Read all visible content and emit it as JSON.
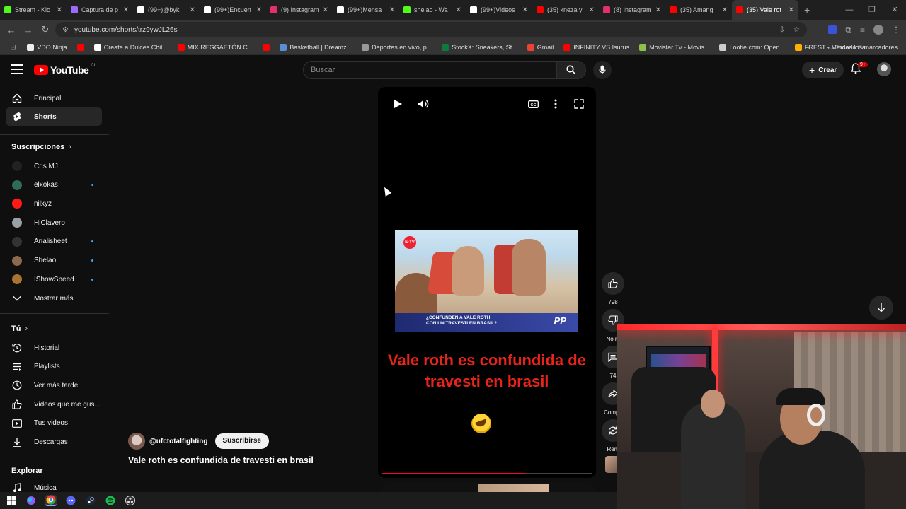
{
  "browser": {
    "tabs": [
      {
        "label": "Stream - Kic",
        "color": "#53fc18"
      },
      {
        "label": "Captura de p",
        "color": "#9b6bff"
      },
      {
        "label": "(99+)@byki",
        "color": "#ffffff"
      },
      {
        "label": "(99+)Encuen",
        "color": "#ffffff"
      },
      {
        "label": "(9) Instagram",
        "color": "#e1306c"
      },
      {
        "label": "(99+)Mensa",
        "color": "#ffffff"
      },
      {
        "label": "shelao - Wa",
        "color": "#53fc18"
      },
      {
        "label": "(99+)Videos",
        "color": "#ffffff"
      },
      {
        "label": "(35) kneza y",
        "color": "#ff0000"
      },
      {
        "label": "(8) Instagram",
        "color": "#e1306c"
      },
      {
        "label": "(35) Amang",
        "color": "#ff0000"
      },
      {
        "label": "(35) Vale rot",
        "color": "#ff0000",
        "active": true
      }
    ],
    "url": "youtube.com/shorts/trz9ywJL26s",
    "bookmarks": [
      {
        "label": "VDO.Ninja",
        "color": "#eeeeee"
      },
      {
        "label": "",
        "color": "#ff0000"
      },
      {
        "label": "Create a Dulces Chil...",
        "color": "#ffffff"
      },
      {
        "label": "MIX REGGAETÓN C...",
        "color": "#ff0000"
      },
      {
        "label": "",
        "color": "#ff0000"
      },
      {
        "label": "Basketball | Dreamz...",
        "color": "#5b8dd6"
      },
      {
        "label": "Deportes en vivo, p...",
        "color": "#999999"
      },
      {
        "label": "StockX: Sneakers, St...",
        "color": "#0f7a3e"
      },
      {
        "label": "Gmail",
        "color": "#ea4335"
      },
      {
        "label": "INFINITY VS Isurus",
        "color": "#ff0000"
      },
      {
        "label": "Movistar Tv - Movis...",
        "color": "#8bc34a"
      },
      {
        "label": "Lootie.com: Open...",
        "color": "#cccccc"
      },
      {
        "label": "FREST - Mercado Sa...",
        "color": "#ffb000"
      }
    ],
    "all_bookmarks": "Todos los marcadores"
  },
  "header": {
    "logo": "YouTube",
    "country": "CL",
    "search_placeholder": "Buscar",
    "create_label": "Crear",
    "notif_badge": "9+"
  },
  "sidebar": {
    "main": [
      {
        "label": "Principal",
        "icon": "home-icon"
      },
      {
        "label": "Shorts",
        "icon": "shorts-icon",
        "active": true
      }
    ],
    "subs_title": "Suscripciones",
    "subs": [
      {
        "label": "Cris MJ",
        "color": "#222222",
        "dot": false
      },
      {
        "label": "elxokas",
        "color": "#2f6b58",
        "dot": true
      },
      {
        "label": "nilxyz",
        "color": "#ff1a1a",
        "dot": false
      },
      {
        "label": "HiClavero",
        "color": "#9aa0a6",
        "dot": false
      },
      {
        "label": "Analisheet",
        "color": "#333333",
        "dot": true
      },
      {
        "label": "Shelao",
        "color": "#8a6a4a",
        "dot": true
      },
      {
        "label": "IShowSpeed",
        "color": "#a8742f",
        "dot": true
      }
    ],
    "show_more": "Mostrar más",
    "you_title": "Tú",
    "you": [
      {
        "label": "Historial",
        "icon": "history-icon"
      },
      {
        "label": "Playlists",
        "icon": "playlist-icon"
      },
      {
        "label": "Ver más tarde",
        "icon": "clock-icon"
      },
      {
        "label": "Videos que me gus...",
        "icon": "like-icon"
      },
      {
        "label": "Tus videos",
        "icon": "video-icon"
      },
      {
        "label": "Descargas",
        "icon": "download-icon"
      }
    ],
    "explore_title": "Explorar",
    "explore": [
      {
        "label": "Música",
        "icon": "music-icon"
      }
    ]
  },
  "short": {
    "thumb_banner": "¿CONFUNDEN A VALE ROTH\nCON UN TRAVESTI EN BRASIL?",
    "thumb_logo": "E-TV",
    "thumb_brand": "PP",
    "caption": "Vale roth es confundida de travesti en brasil",
    "progress": 0.68,
    "channel": "@ufctotalfighting",
    "subscribe_label": "Suscribirse",
    "title": "Vale roth es confundida de travesti en brasil"
  },
  "actions": {
    "like_count": "798",
    "dislike_label": "No m",
    "comments_count": "74",
    "share_label": "Compa",
    "remix_label": "Rem"
  }
}
